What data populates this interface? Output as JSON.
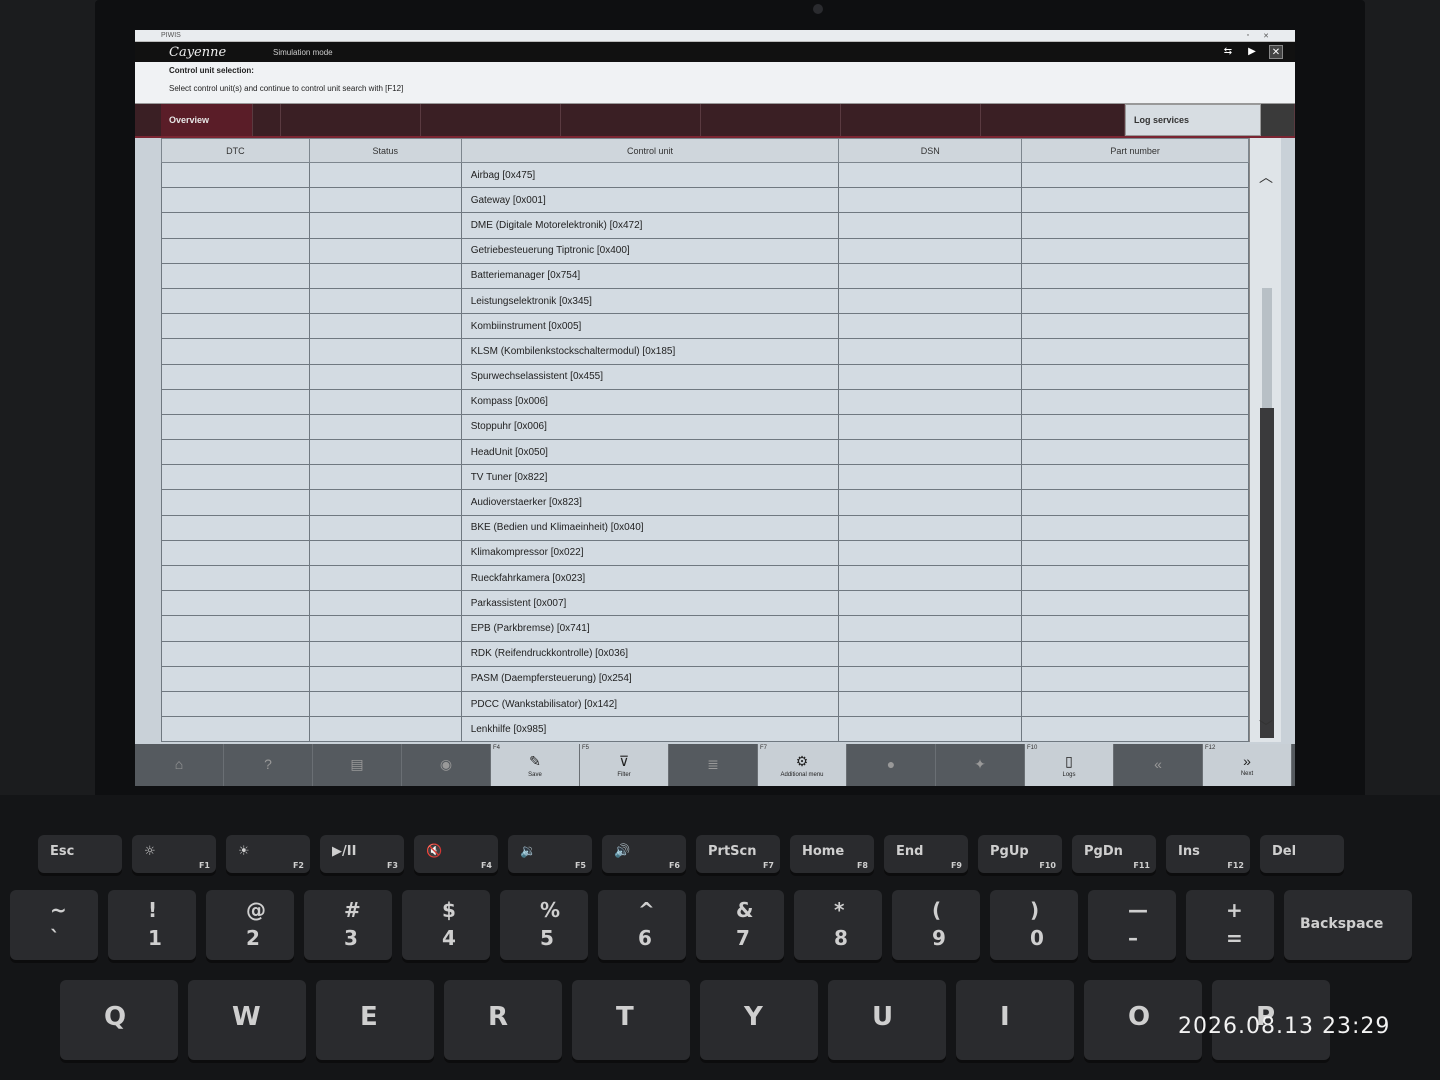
{
  "window": {
    "title": "PIWIS",
    "brand": "Cayenne",
    "mode": "Simulation mode"
  },
  "instructions": {
    "heading": "Control unit selection:",
    "text": "Select control unit(s) and continue to control unit search with [F12]"
  },
  "tabs": {
    "overview": "Overview",
    "log_services": "Log services"
  },
  "table": {
    "headers": [
      "DTC",
      "Status",
      "Control unit",
      "DSN",
      "Part number"
    ],
    "rows": [
      "Airbag [0x475]",
      "Gateway [0x001]",
      "DME (Digitale Motorelektronik) [0x472]",
      "Getriebesteuerung Tiptronic [0x400]",
      "Batteriemanager [0x754]",
      "Leistungselektronik [0x345]",
      "Kombiinstrument [0x005]",
      "KLSM (Kombilenkstockschaltermodul) [0x185]",
      "Spurwechselassistent [0x455]",
      "Kompass [0x006]",
      "Stoppuhr [0x006]",
      "HeadUnit [0x050]",
      "TV Tuner [0x822]",
      "Audioverstaerker [0x823]",
      "BKE (Bedien und Klimaeinheit) [0x040]",
      "Klimakompressor [0x022]",
      "Rueckfahrkamera [0x023]",
      "Parkassistent [0x007]",
      "EPB (Parkbremse) [0x741]",
      "RDK (Reifendruckkontrolle) [0x036]",
      "PASM (Daempfersteuerung) [0x254]",
      "PDCC (Wankstabilisator) [0x142]",
      "Lenkhilfe [0x985]"
    ]
  },
  "toolbar": [
    {
      "fkey": "",
      "label": "",
      "icon": "home-icon",
      "active": false
    },
    {
      "fkey": "",
      "label": "",
      "icon": "help-icon",
      "active": false
    },
    {
      "fkey": "",
      "label": "",
      "icon": "document-icon",
      "active": false
    },
    {
      "fkey": "",
      "label": "",
      "icon": "car-icon",
      "active": false
    },
    {
      "fkey": "F4",
      "label": "Save",
      "icon": "save-icon",
      "active": true
    },
    {
      "fkey": "F5",
      "label": "Filter",
      "icon": "filter-icon",
      "active": true
    },
    {
      "fkey": "",
      "label": "",
      "icon": "list-icon",
      "active": false
    },
    {
      "fkey": "F7",
      "label": "Additional menu",
      "icon": "wrench-icon",
      "active": true
    },
    {
      "fkey": "",
      "label": "",
      "icon": "play-icon",
      "active": false
    },
    {
      "fkey": "",
      "label": "",
      "icon": "chat-icon",
      "active": false
    },
    {
      "fkey": "F10",
      "label": "Logs",
      "icon": "log-icon",
      "active": true
    },
    {
      "fkey": "",
      "label": "",
      "icon": "back-icon",
      "active": false
    },
    {
      "fkey": "F12",
      "label": "Next",
      "icon": "next-icon",
      "active": true
    }
  ],
  "keyboard": {
    "frow": [
      {
        "m": "Esc",
        "f": ""
      },
      {
        "m": "☼",
        "f": "F1"
      },
      {
        "m": "☀",
        "f": "F2"
      },
      {
        "m": "▶/II",
        "f": "F3"
      },
      {
        "m": "🔇",
        "f": "F4"
      },
      {
        "m": "🔉",
        "f": "F5"
      },
      {
        "m": "🔊",
        "f": "F6"
      },
      {
        "m": "PrtScn",
        "f": "F7"
      },
      {
        "m": "Home",
        "f": "F8"
      },
      {
        "m": "End",
        "f": "F9"
      },
      {
        "m": "PgUp",
        "f": "F10"
      },
      {
        "m": "PgDn",
        "f": "F11"
      },
      {
        "m": "Ins",
        "f": "F12"
      },
      {
        "m": "Del",
        "f": ""
      }
    ],
    "nrow": [
      {
        "t": "~",
        "b": "`"
      },
      {
        "t": "!",
        "b": "1"
      },
      {
        "t": "@",
        "b": "2"
      },
      {
        "t": "#",
        "b": "3"
      },
      {
        "t": "$",
        "b": "4"
      },
      {
        "t": "%",
        "b": "5"
      },
      {
        "t": "^",
        "b": "6"
      },
      {
        "t": "&",
        "b": "7"
      },
      {
        "t": "*",
        "b": "8"
      },
      {
        "t": "(",
        "b": "9"
      },
      {
        "t": ")",
        "b": "0"
      },
      {
        "t": "—",
        "b": "–"
      },
      {
        "t": "+",
        "b": "="
      },
      {
        "t": "Backspace",
        "b": ""
      }
    ],
    "qrow": [
      "Q",
      "W",
      "E",
      "R",
      "T",
      "Y",
      "U",
      "I",
      "O",
      "P"
    ]
  },
  "timestamp": "2026.08.13 23:29"
}
